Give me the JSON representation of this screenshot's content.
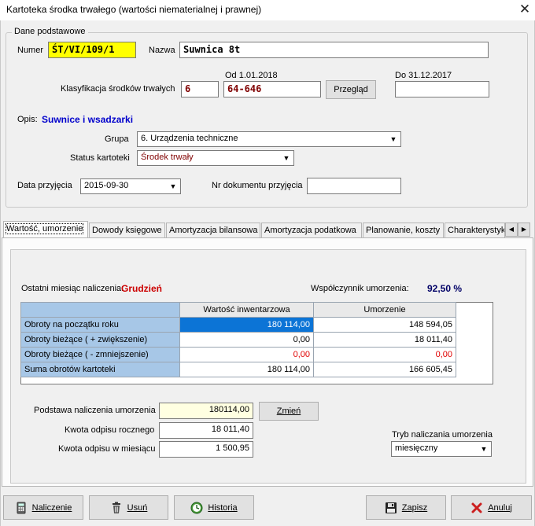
{
  "window": {
    "title": "Kartoteka środka trwałego (wartości niematerialnej i prawnej)"
  },
  "dane": {
    "legend": "Dane podstawowe",
    "numer_label": "Numer",
    "numer_value": "ŚT/VI/109/1",
    "nazwa_label": "Nazwa",
    "nazwa_value": "Suwnica 8t",
    "klasyfikacja_label": "Klasyfikacja środków trwałych",
    "od_label": "Od 1.01.2018",
    "do_label": "Do 31.12.2017",
    "klas_1": "6",
    "klas_2": "64-646",
    "klas_3": "",
    "przeglad_button": "Przegląd",
    "opis_label": "Opis:",
    "opis_value": "Suwnice i wsadzarki",
    "grupa_label": "Grupa",
    "grupa_value": "6. Urządzenia techniczne",
    "status_label": "Status kartoteki",
    "status_value": "Środek trwały",
    "data_label": "Data przyjęcia",
    "data_value": "2015-09-30",
    "nrdok_label": "Nr dokumentu przyjęcia",
    "nrdok_value": ""
  },
  "tabs": [
    {
      "label": "Wartość, umorzenie"
    },
    {
      "label": "Dowody księgowe"
    },
    {
      "label": "Amortyzacja bilansowa"
    },
    {
      "label": "Amortyzacja podatkowa"
    },
    {
      "label": "Planowanie, koszty"
    },
    {
      "label": "Charakterystyka"
    }
  ],
  "wartosc": {
    "ostatni_label": "Ostatni miesiąc naliczenia:",
    "ostatni_value": "Grudzień",
    "wspolczynnik_label": "Współczynnik umorzenia:",
    "wspolczynnik_value": "92,50 %",
    "table": {
      "headers": [
        "Wartość inwentarzowa",
        "Umorzenie"
      ],
      "rows": [
        {
          "label": "Obroty na początku roku",
          "v1": "180 114,00",
          "v2": "148 594,05"
        },
        {
          "label": "Obroty bieżące ( + zwiększenie)",
          "v1": "0,00",
          "v2": "18 011,40"
        },
        {
          "label": "Obroty bieżące ( - zmniejszenie)",
          "v1": "0,00",
          "v2": "0,00"
        },
        {
          "label": "Suma obrotów kartoteki",
          "v1": "180 114,00",
          "v2": "166 605,45"
        }
      ]
    },
    "podstawa_label": "Podstawa naliczenia umorzenia",
    "podstawa_value": "180114,00",
    "zmien_button": "Zmień",
    "roczny_label": "Kwota odpisu rocznego",
    "roczny_value": "18 011,40",
    "miesiac_label": "Kwota odpisu w miesiącu",
    "miesiac_value": "1 500,95",
    "tryb_label": "Tryb naliczania umorzenia",
    "tryb_value": "miesięczny"
  },
  "buttons": {
    "naliczenie": "Naliczenie",
    "usun": "Usuń",
    "historia": "Historia",
    "zapisz": "Zapisz",
    "anuluj": "Anuluj"
  },
  "colors": {
    "yellow_field": "#ffff00",
    "opis_blue": "#0000cc",
    "month_red": "#cc0000",
    "selected_cell": "#0c74d6",
    "row_header": "#a7c7e7"
  }
}
